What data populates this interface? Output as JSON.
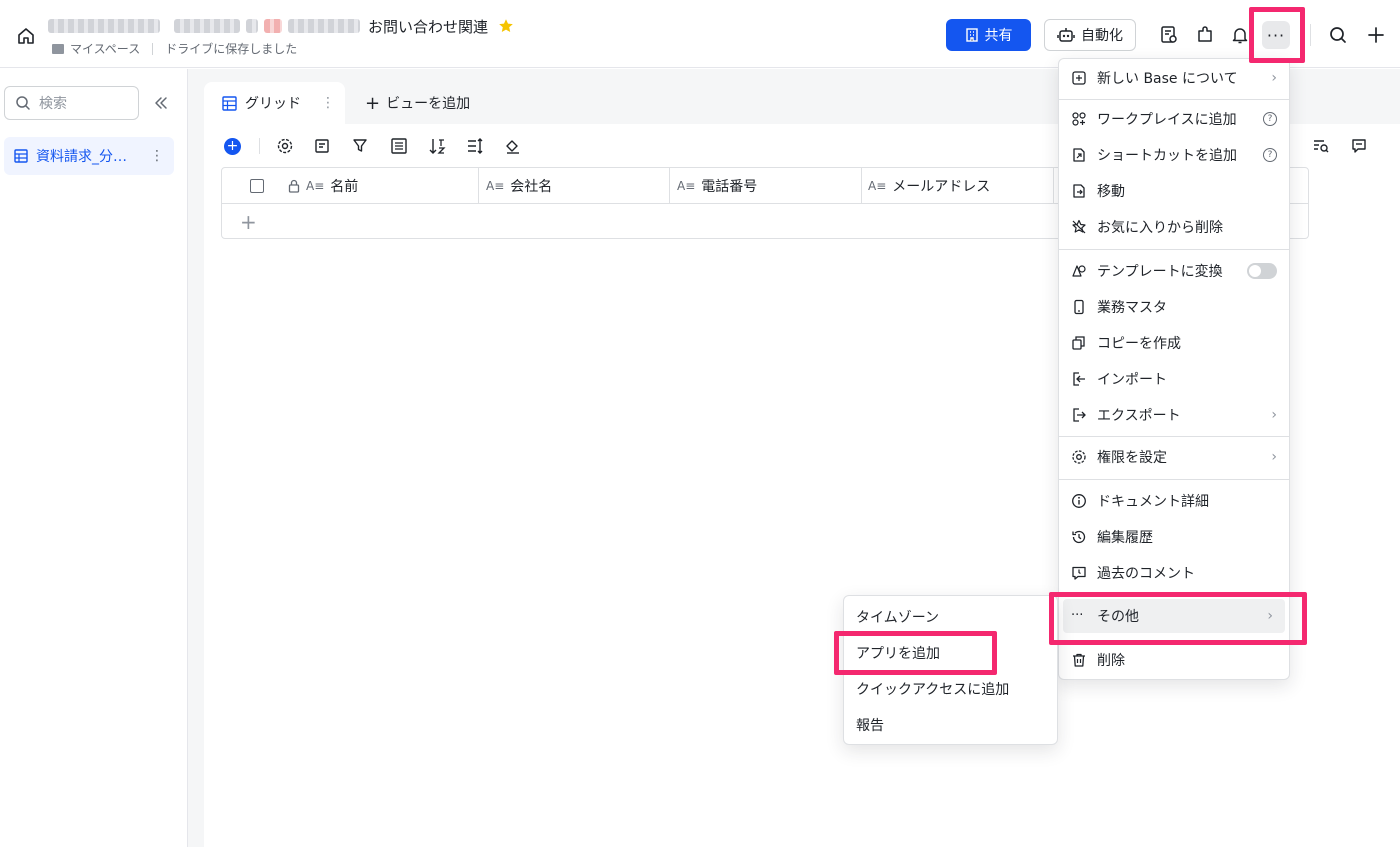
{
  "header": {
    "title": "お問い合わせ関連",
    "breadcrumb_space": "マイスペース",
    "save_status": "ドライブに保存しました",
    "share_label": "共有",
    "automation_label": "自動化"
  },
  "sidebar": {
    "search_placeholder": "検索",
    "table_name": "資料請求_分…"
  },
  "tabs": {
    "active_view": "グリッド",
    "add_view_label": "ビューを追加"
  },
  "grid": {
    "columns": [
      "名前",
      "会社名",
      "電話番号",
      "メールアドレス"
    ]
  },
  "menu": {
    "items": [
      {
        "label": "新しい Base について",
        "icon": "base-info-icon"
      },
      {
        "label": "ワークプレイスに追加",
        "icon": "workplace-icon"
      },
      {
        "label": "ショートカットを追加",
        "icon": "shortcut-icon"
      },
      {
        "label": "移動",
        "icon": "move-icon"
      },
      {
        "label": "お気に入りから削除",
        "icon": "unstar-icon"
      },
      {
        "label": "テンプレートに変換",
        "icon": "template-icon"
      },
      {
        "label": "業務マスタ",
        "icon": "phone-icon"
      },
      {
        "label": "コピーを作成",
        "icon": "copy-icon"
      },
      {
        "label": "インポート",
        "icon": "import-icon"
      },
      {
        "label": "エクスポート",
        "icon": "export-icon"
      },
      {
        "label": "権限を設定",
        "icon": "gear-icon"
      },
      {
        "label": "ドキュメント詳細",
        "icon": "info-icon"
      },
      {
        "label": "編集履歴",
        "icon": "history-icon"
      },
      {
        "label": "過去のコメント",
        "icon": "comment-icon"
      },
      {
        "label": "その他",
        "icon": "more-icon"
      },
      {
        "label": "削除",
        "icon": "trash-icon"
      }
    ],
    "template_toggle_on": false
  },
  "submenu": {
    "items": [
      "タイムゾーン",
      "アプリを追加",
      "クイックアクセスに追加",
      "報告"
    ]
  },
  "colors": {
    "accent": "#1456f0",
    "highlight": "#f4286f",
    "star": "#f5c400"
  }
}
